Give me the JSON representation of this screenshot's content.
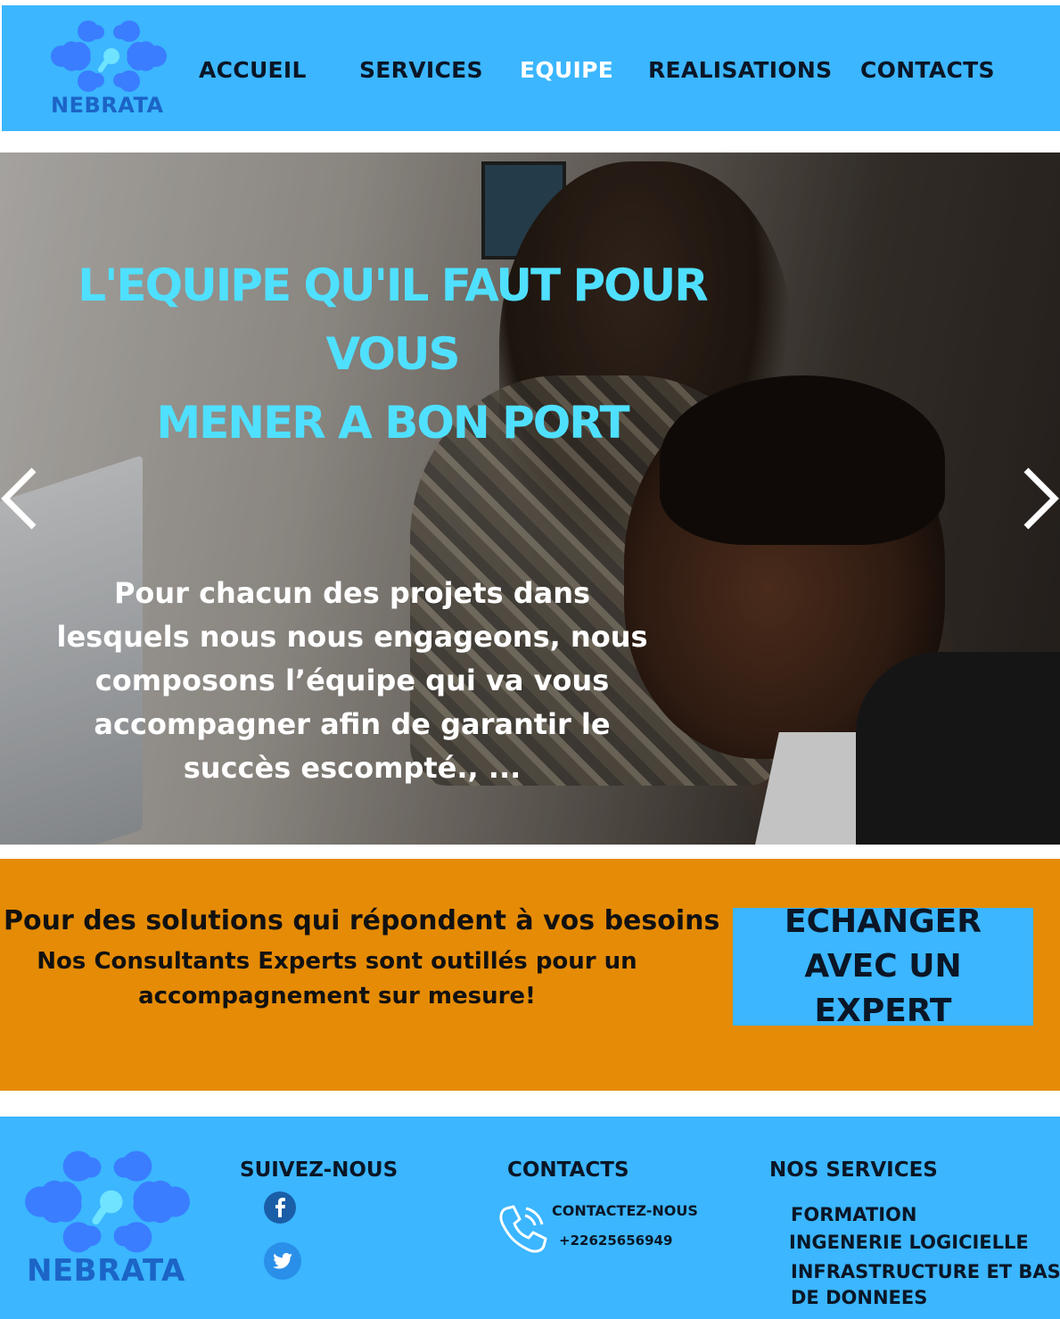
{
  "header": {
    "brand": "NEBRATA",
    "nav": [
      {
        "label": "ACCUEIL",
        "active": false
      },
      {
        "label": "SERVICES",
        "active": false
      },
      {
        "label": "EQUIPE",
        "active": true
      },
      {
        "label": "REALISATIONS",
        "active": false
      },
      {
        "label": "CONTACTS",
        "active": false
      }
    ]
  },
  "hero": {
    "title_line1": "L'EQUIPE QU'IL FAUT POUR VOUS",
    "title_line2": "MENER A BON PORT",
    "text": "Pour chacun des projets dans lesquels nous nous engageons, nous composons l’équipe qui va vous accompagner afin de garantir le succès escompté., ...",
    "prev_icon": "chevron-left-icon",
    "next_icon": "chevron-right-icon"
  },
  "band": {
    "heading": "Pour des solutions qui répondent à vos besoins",
    "text": "Nos Consultants Experts sont outillés pour un accompagnement sur mesure!",
    "cta_label": "ECHANGER AVEC UN EXPERT"
  },
  "footer": {
    "brand": "NEBRATA",
    "follow_title": "SUIVEZ-NOUS",
    "social": [
      {
        "name": "facebook-icon"
      },
      {
        "name": "twitter-icon"
      }
    ],
    "contacts_title": "CONTACTS",
    "contact_label": "CONTACTEZ-NOUS",
    "phone": "+22625656949",
    "services_title": "NOS SERVICES",
    "services": [
      "FORMATION",
      "INGENERIE LOGICIELLE",
      "INFRASTRUCTURE ET BASE",
      "DE DONNEES"
    ]
  },
  "colors": {
    "primary": "#3bb6ff",
    "logo": "#3a7dff",
    "accent_orange": "#e58b06",
    "hero_title": "#4fe0ff",
    "dark_text": "#0a1626"
  }
}
